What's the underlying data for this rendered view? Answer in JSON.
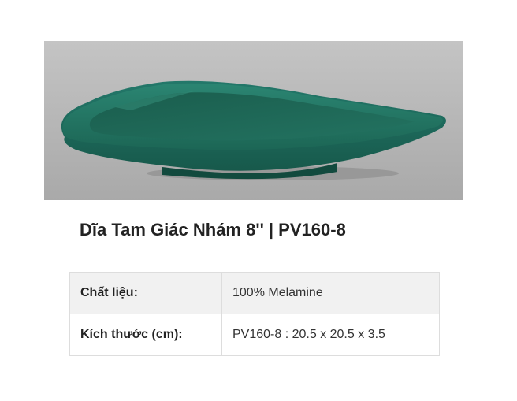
{
  "product": {
    "title": "Dĩa Tam Giác Nhám 8'' | PV160-8",
    "colors": {
      "dish": "#1f6b5a",
      "background": "#b9b9b9"
    },
    "specs": [
      {
        "label": "Chất liệu:",
        "value": "100% Melamine"
      },
      {
        "label": "Kích thước (cm):",
        "value": "PV160-8 : 20.5 x 20.5 x 3.5"
      }
    ]
  }
}
